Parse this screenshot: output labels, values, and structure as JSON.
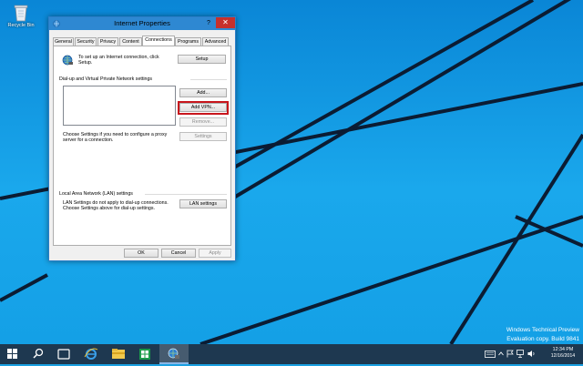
{
  "desktop": {
    "recycle_bin_label": "Recycle Bin",
    "watermark": {
      "line1": "Windows Technical Preview",
      "line2": "Evaluation copy. Build 9841"
    }
  },
  "dialog": {
    "title": "Internet Properties",
    "help_glyph": "?",
    "close_glyph": "✕",
    "tabs": [
      {
        "label": "General"
      },
      {
        "label": "Security"
      },
      {
        "label": "Privacy"
      },
      {
        "label": "Content"
      },
      {
        "label": "Connections",
        "active": true
      },
      {
        "label": "Programs"
      },
      {
        "label": "Advanced"
      }
    ],
    "connections": {
      "setup_text_1": "To set up an Internet connection, click",
      "setup_text_2": "Setup.",
      "setup_button": "Setup",
      "dialup_group": "Dial-up and Virtual Private Network settings",
      "add_button": "Add...",
      "add_vpn_button": "Add VPN...",
      "remove_button": "Remove...",
      "proxy_text_1": "Choose Settings if you need to configure a proxy",
      "proxy_text_2": "server for a connection.",
      "settings_button": "Settings",
      "lan_group": "Local Area Network (LAN) settings",
      "lan_text_1": "LAN Settings do not apply to dial-up connections.",
      "lan_text_2": "Choose Settings above for dial-up settings.",
      "lan_button": "LAN settings"
    },
    "footer": {
      "ok": "OK",
      "cancel": "Cancel",
      "apply": "Apply"
    }
  },
  "taskbar": {
    "icons": [
      "windows-start-icon",
      "search-icon",
      "task-view-icon",
      "internet-explorer-icon",
      "file-explorer-icon",
      "store-icon",
      "internet-properties-icon"
    ],
    "clock": {
      "time": "12:34 PM",
      "date": "12/16/2014"
    }
  },
  "colors": {
    "accent": "#2e88d2",
    "highlight": "#c8161d",
    "taskbar": "#1e3850",
    "desktop": "#1aa8ec"
  }
}
